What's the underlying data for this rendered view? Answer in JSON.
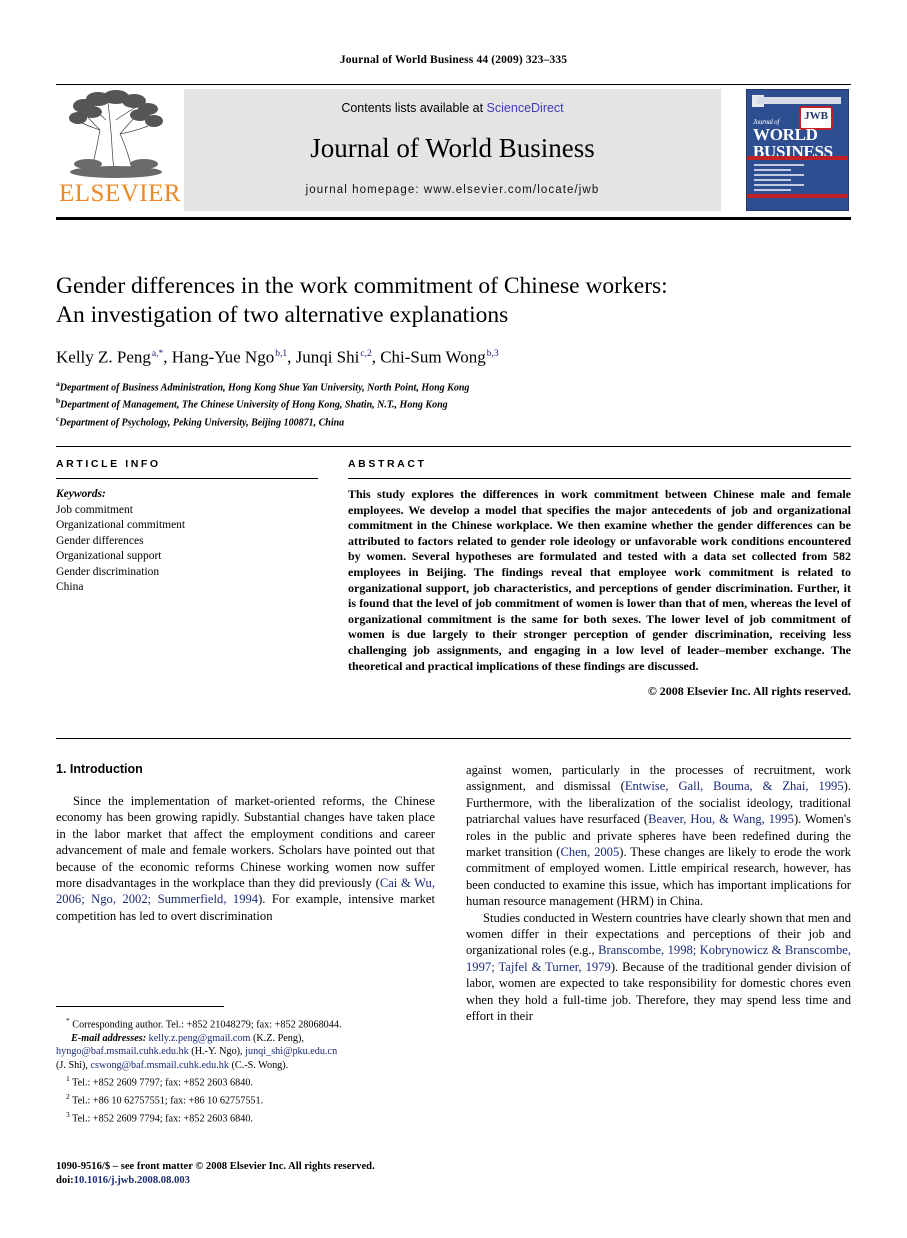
{
  "running_head": "Journal of World Business 44 (2009) 323–335",
  "masthead": {
    "contents_prefix": "Contents lists available at ",
    "sciencedirect": "ScienceDirect",
    "journal_name": "Journal of World Business",
    "homepage": "journal homepage: www.elsevier.com/locate/jwb",
    "publisher_wordmark": "ELSEVIER",
    "publisher_color": "#ee8822",
    "sciencedirect_color": "#3c3cb4",
    "cover": {
      "line1": "Journal of",
      "line2": "WORLD",
      "line3": "BUSINESS",
      "badge": "JWB",
      "bg_color": "#2e4e92",
      "rule_color": "#c02026"
    }
  },
  "article": {
    "title_line1": "Gender differences in the work commitment of Chinese workers:",
    "title_line2": "An investigation of two alternative explanations",
    "authors": [
      {
        "name": "Kelly Z. Peng",
        "marks": "a,*",
        "sep": ", "
      },
      {
        "name": "Hang-Yue Ngo",
        "marks": "b,1",
        "sep": ", "
      },
      {
        "name": "Junqi Shi",
        "marks": "c,2",
        "sep": ", "
      },
      {
        "name": "Chi-Sum Wong",
        "marks": "b,3",
        "sep": ""
      }
    ],
    "affiliations": [
      {
        "mark": "a",
        "text": "Department of Business Administration, Hong Kong Shue Yan University, North Point, Hong Kong"
      },
      {
        "mark": "b",
        "text": "Department of Management, The Chinese University of Hong Kong, Shatin, N.T., Hong Kong"
      },
      {
        "mark": "c",
        "text": "Department of Psychology, Peking University, Beijing 100871, China"
      }
    ]
  },
  "article_info": {
    "heading": "ARTICLE INFO",
    "keywords_label": "Keywords:",
    "keywords": [
      "Job commitment",
      "Organizational commitment",
      "Gender differences",
      "Organizational support",
      "Gender discrimination",
      "China"
    ]
  },
  "abstract": {
    "heading": "ABSTRACT",
    "text": "This study explores the differences in work commitment between Chinese male and female employees. We develop a model that specifies the major antecedents of job and organizational commitment in the Chinese workplace. We then examine whether the gender differences can be attributed to factors related to gender role ideology or unfavorable work conditions encountered by women. Several hypotheses are formulated and tested with a data set collected from 582 employees in Beijing. The findings reveal that employee work commitment is related to organizational support, job characteristics, and perceptions of gender discrimination. Further, it is found that the level of job commitment of women is lower than that of men, whereas the level of organizational commitment is the same for both sexes. The lower level of job commitment of women is due largely to their stronger perception of gender discrimination, receiving less challenging job assignments, and engaging in a low level of leader–member exchange. The theoretical and practical implications of these findings are discussed.",
    "copyright": "© 2008 Elsevier Inc. All rights reserved."
  },
  "body": {
    "section_heading": "1. Introduction",
    "left_paragraph_1_a": "Since the implementation of market-oriented reforms, the Chinese economy has been growing rapidly. Substantial changes have taken place in the labor market that affect the employment conditions and career advancement of male and female workers. Scholars have pointed out that because of the economic reforms Chinese working women now suffer more disadvantages in the workplace than they did previously (",
    "left_cite_1": "Cai & Wu, 2006; Ngo, 2002; Summerfield, 1994",
    "left_paragraph_1_b": "). For example, intensive market competition has led to overt discrimination",
    "right_paragraph_1_a": "against women, particularly in the processes of recruitment, work assignment, and dismissal (",
    "right_cite_1": "Entwise, Gall, Bouma, & Zhai, 1995",
    "right_paragraph_1_b": "). Furthermore, with the liberalization of the socialist ideology, traditional patriarchal values have resurfaced (",
    "right_cite_2": "Beaver, Hou, & Wang, 1995",
    "right_paragraph_1_c": "). Women's roles in the public and private spheres have been redefined during the market transition (",
    "right_cite_3": "Chen, 2005",
    "right_paragraph_1_d": "). These changes are likely to erode the work commitment of employed women. Little empirical research, however, has been conducted to examine this issue, which has important implications for human resource management (HRM) in China.",
    "right_paragraph_2_a": "Studies conducted in Western countries have clearly shown that men and women differ in their expectations and perceptions of their job and organizational roles (e.g., ",
    "right_cite_4": "Branscombe, 1998; Kobrynowicz & Branscombe, 1997; Tajfel & Turner, 1979",
    "right_paragraph_2_b": "). Because of the traditional gender division of labor, women are expected to take responsibility for domestic chores even when they hold a full-time job. Therefore, they may spend less time and effort in their"
  },
  "footnotes": {
    "corresponding": "Corresponding author. Tel.: +852 21048279; fax: +852 28068044.",
    "email_label": "E-mail addresses:",
    "email_1": "kelly.z.peng@gmail.com",
    "email_1_who": "(K.Z. Peng),",
    "email_2": "hyngo@baf.msmail.cuhk.edu.hk",
    "email_2_who": "(H.-Y. Ngo),",
    "email_3": "junqi_shi@pku.edu.cn",
    "email_3_who": "(J. Shi),",
    "email_4": "cswong@baf.msmail.cuhk.edu.hk",
    "email_4_who": "(C.-S. Wong).",
    "note_1": "Tel.: +852 2609 7797; fax: +852 2603 6840.",
    "note_2": "Tel.: +86 10 62757551; fax: +86 10 62757551.",
    "note_3": "Tel.: +852 2609 7794; fax: +852 2603 6840."
  },
  "imprint": {
    "issn_line": "1090-9516/$ – see front matter © 2008 Elsevier Inc. All rights reserved.",
    "doi_label": "doi:",
    "doi_value": "10.1016/j.jwb.2008.08.003"
  }
}
